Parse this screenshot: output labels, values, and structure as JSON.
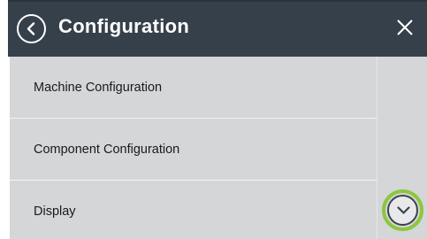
{
  "header": {
    "title": "Configuration"
  },
  "menu": {
    "items": [
      {
        "label": "Machine Configuration"
      },
      {
        "label": "Component Configuration"
      },
      {
        "label": "Display"
      }
    ]
  },
  "icons": {
    "back": "chevron-left-circle-icon",
    "close": "close-icon",
    "scroll_down": "chevron-down-circle-icon"
  },
  "colors": {
    "header_bg": "#36404a",
    "list_bg": "#d4d6d8",
    "highlight_ring": "#8cc63f"
  }
}
